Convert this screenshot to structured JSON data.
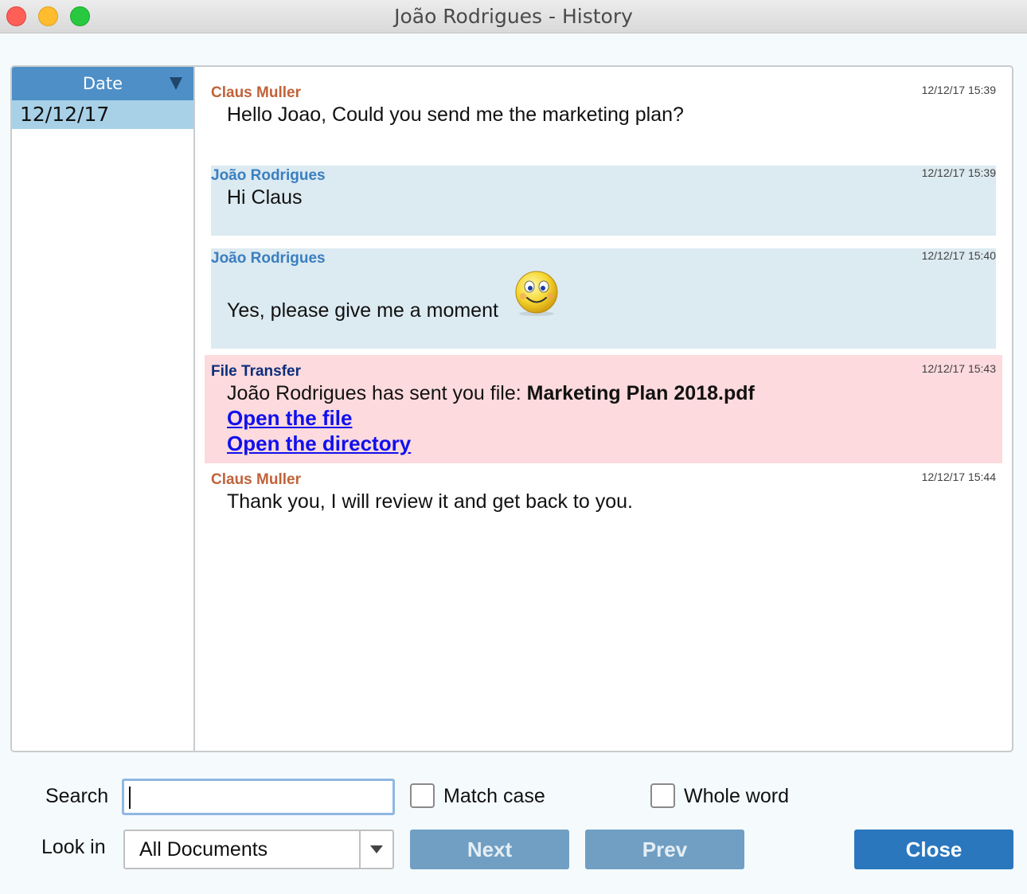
{
  "window": {
    "title": "João Rodrigues - History"
  },
  "sidebar": {
    "header": "Date",
    "dates": [
      "12/12/17"
    ]
  },
  "messages": [
    {
      "sender": "Claus Muller",
      "timestamp": "12/12/17 15:39",
      "text": "Hello Joao, Could you send me the marketing plan?"
    },
    {
      "sender": "João Rodrigues",
      "timestamp": "12/12/17 15:39",
      "text": "Hi Claus"
    },
    {
      "sender": "João Rodrigues",
      "timestamp": "12/12/17 15:40",
      "text": "Yes, please give me a moment",
      "emoticon": "smiley-icon"
    },
    {
      "sender": "File Transfer",
      "timestamp": "12/12/17 15:43",
      "text": "João Rodrigues has sent you file: ",
      "file_name": "Marketing Plan 2018.pdf",
      "links": [
        "Open the file",
        "Open the directory"
      ]
    },
    {
      "sender": "Claus Muller",
      "timestamp": "12/12/17 15:44",
      "text": "Thank you, I will review it and get back to you."
    }
  ],
  "search": {
    "label": "Search",
    "value": "",
    "match_case_label": "Match case",
    "whole_word_label": "Whole word",
    "match_case_checked": false,
    "whole_word_checked": false,
    "look_in_label": "Look in",
    "look_in_value": "All Documents"
  },
  "buttons": {
    "next": "Next",
    "prev": "Prev",
    "close": "Close"
  },
  "colors": {
    "header_blue": "#4e8fc7",
    "selected_date": "#a8d1e8",
    "sender_orange": "#c0623a",
    "sender_blue": "#3a7fc0",
    "transfer_navy": "#0c2e7c",
    "transfer_bg": "#fddadd",
    "own_msg_bg": "#dceaf1",
    "primary_button": "#2a77be"
  }
}
